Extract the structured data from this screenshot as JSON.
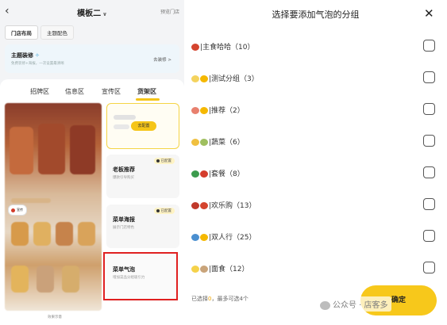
{
  "left_screen": {
    "back_icon": "chevron-left-icon",
    "title": "模板二",
    "preview_link": "预览门店",
    "segments": [
      "门店布局",
      "主题配色"
    ],
    "theme_banner": {
      "title": "主题装修",
      "subtitle": "免费装修+海报，一次设置最清晰",
      "action": "去装修 >"
    },
    "tabs": [
      "招牌区",
      "信息区",
      "宣传区",
      "货架区"
    ],
    "active_tab": "货架区",
    "poster_caption": "效果示意",
    "poster_badge": "宣传",
    "shelf_cards": [
      {
        "name": "",
        "sub": "",
        "button": "去配置",
        "badge": ""
      },
      {
        "name": "老板推荐",
        "sub": "爆款引导购买",
        "badge": "已配置"
      },
      {
        "name": "菜单海报",
        "sub": "展示门店特色",
        "badge": "已配置"
      },
      {
        "name": "菜单气泡",
        "sub": "增加菜品分组吸引力",
        "badge": ""
      }
    ]
  },
  "dialog": {
    "title": "选择要添加气泡的分组",
    "close_icon": "close-icon",
    "groups": [
      {
        "label": "|主食哈哈（10）",
        "icons": [
          "#d4442e"
        ]
      },
      {
        "label": "|测试分组（3）",
        "icons": [
          "#f4d35e",
          "#f5b800"
        ]
      },
      {
        "label": "|推荐（2）",
        "icons": [
          "#e8806e",
          "#f5b800"
        ]
      },
      {
        "label": "|蔬菜（6）",
        "icons": [
          "#f0c040",
          "#9fbf5f"
        ]
      },
      {
        "label": "|套餐（8）",
        "icons": [
          "#3c9b4d",
          "#d43d2c"
        ]
      },
      {
        "label": "|欢乐购（13）",
        "icons": [
          "#c0392b",
          "#d4442e"
        ]
      },
      {
        "label": "|双人行（25）",
        "icons": [
          "#4a8fd0",
          "#f5b800"
        ]
      },
      {
        "label": "|面食（12）",
        "icons": [
          "#f5d24a",
          "#c9a47a"
        ]
      }
    ],
    "selection_text": "已选择",
    "selection_count": "0",
    "selection_suffix": "，最多可选4个",
    "confirm_label": "确定"
  },
  "watermark": "公众号 · 店客多"
}
